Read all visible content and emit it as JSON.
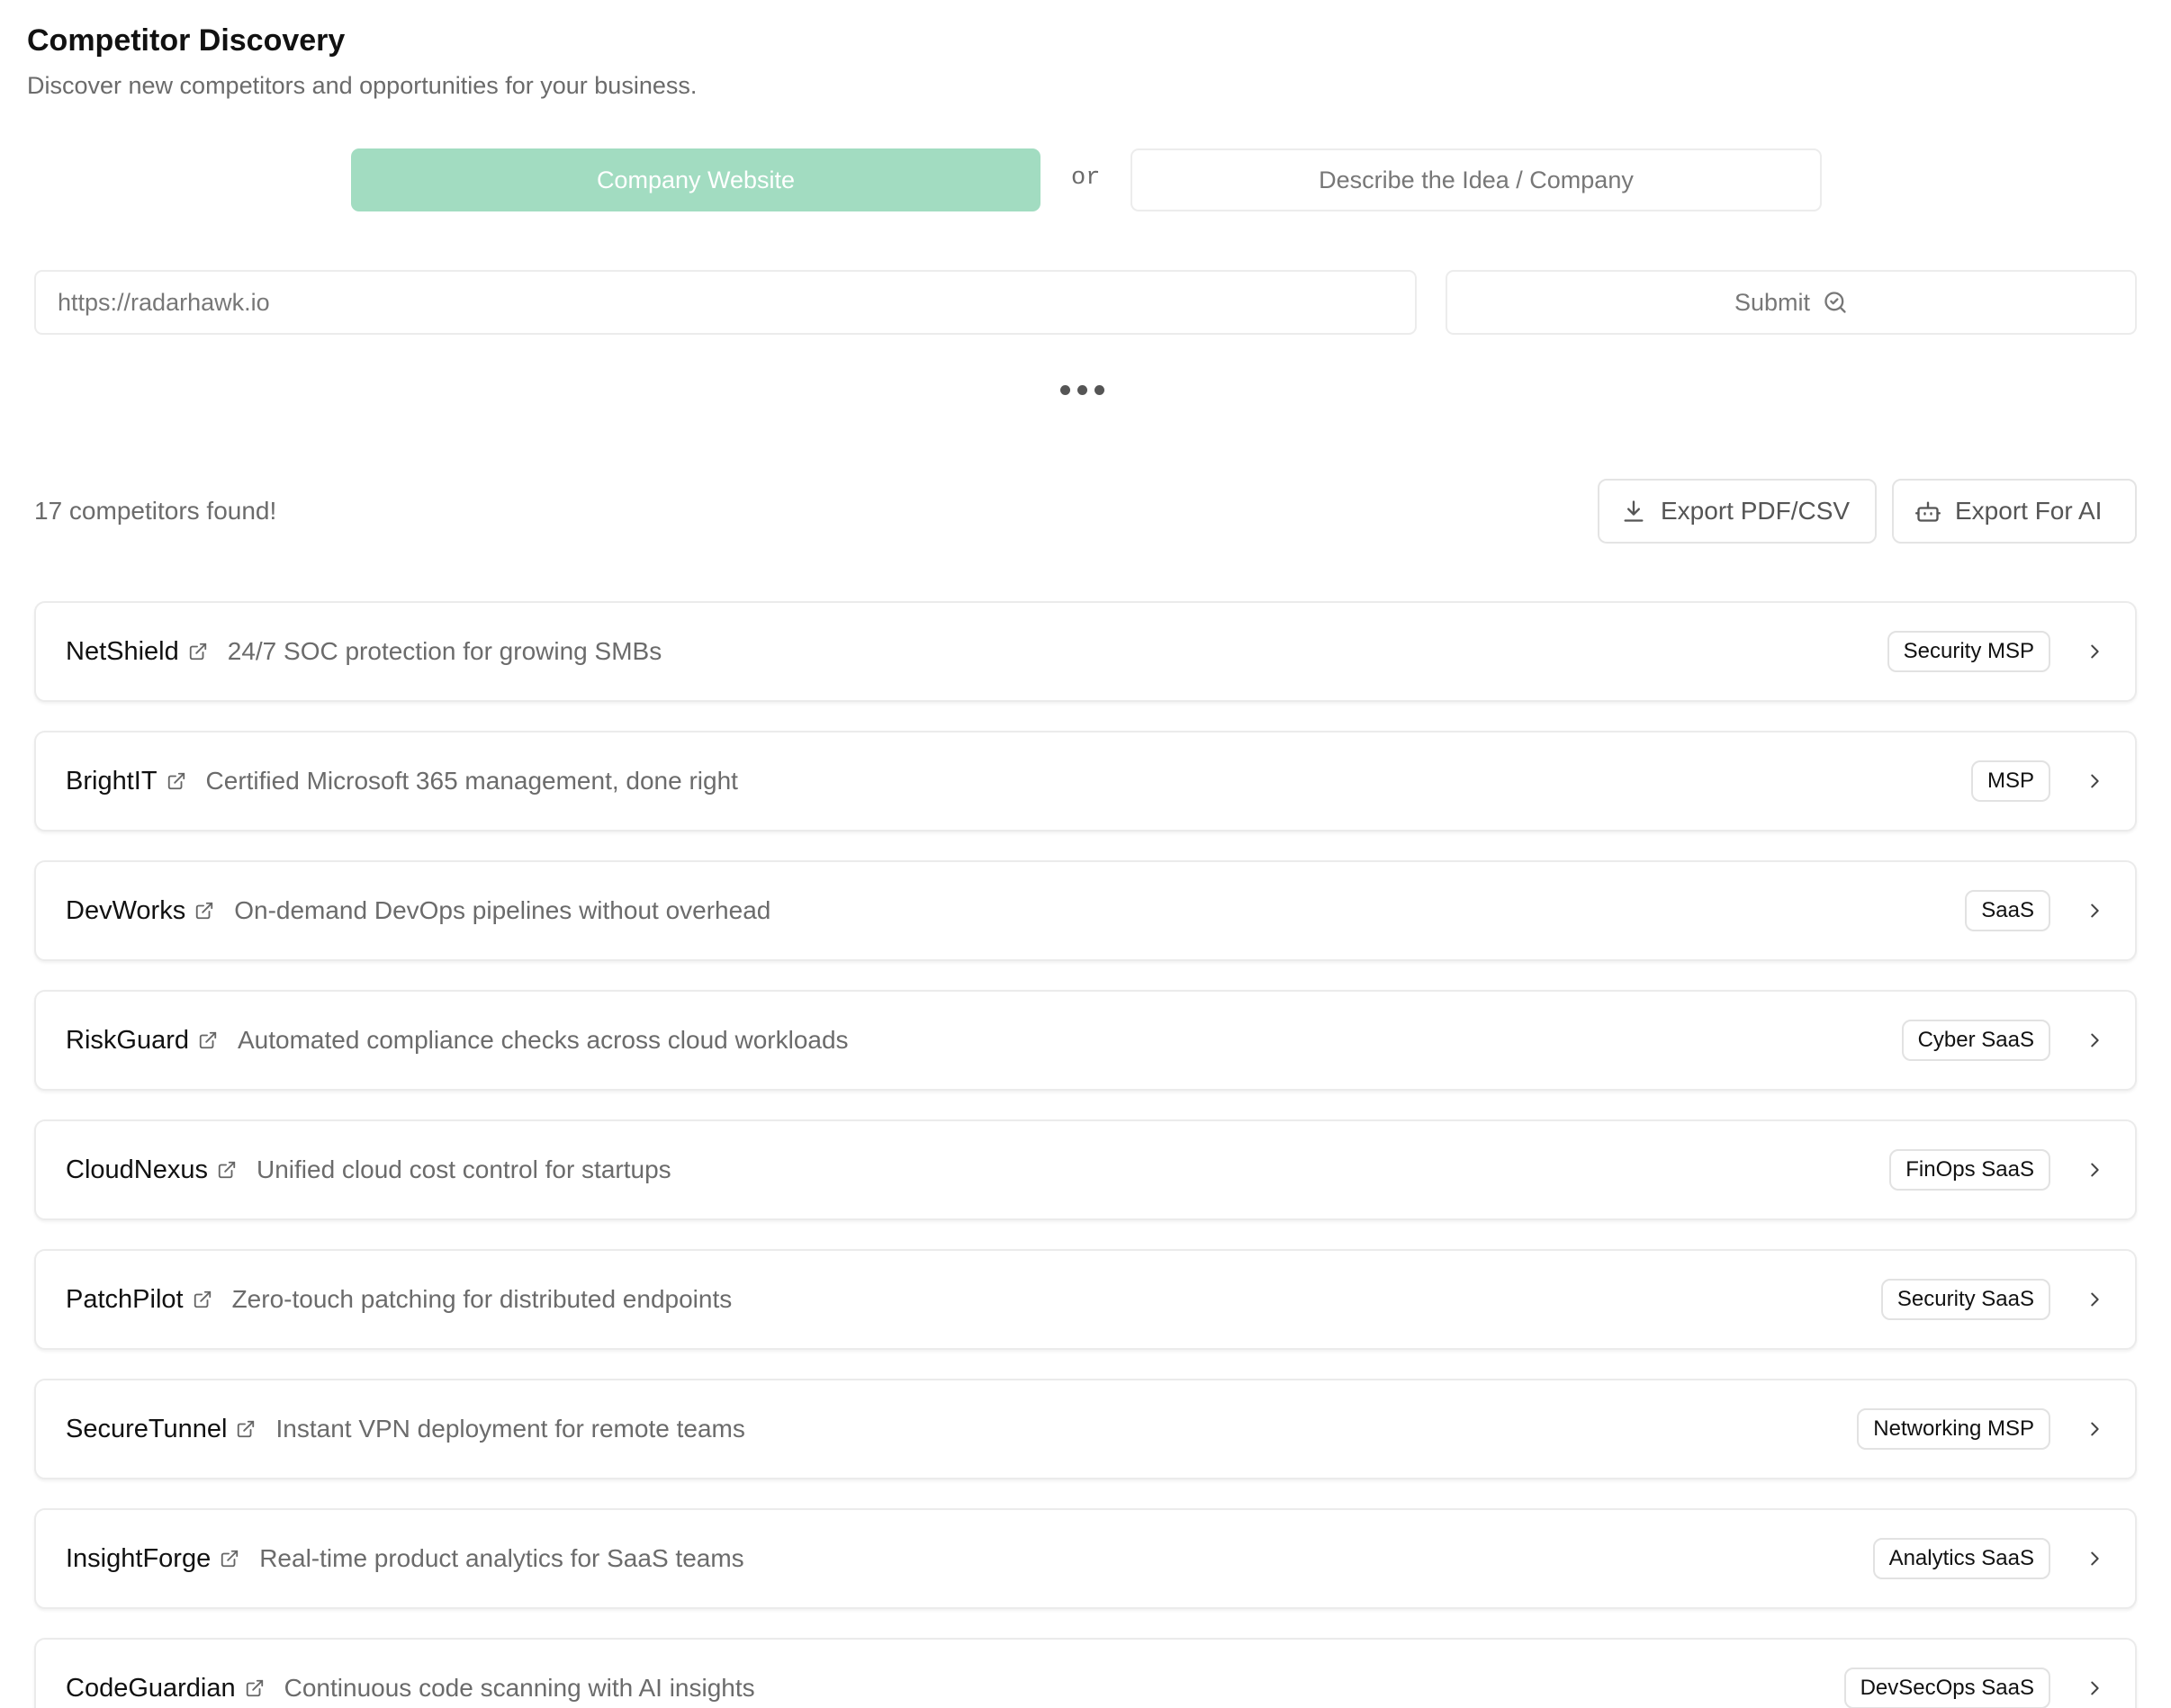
{
  "header": {
    "title": "Competitor Discovery",
    "subtitle": "Discover new competitors and opportunities for your business."
  },
  "mode": {
    "active_label": "Company Website",
    "or_label": "or",
    "inactive_label": "Describe the Idea / Company"
  },
  "search": {
    "placeholder": "https://radarhawk.io",
    "submit_label": "Submit"
  },
  "results": {
    "count_label": "17 competitors found!",
    "export_pdf_label": "Export PDF/CSV",
    "export_ai_label": "Export For AI"
  },
  "competitors": [
    {
      "name": "NetShield",
      "description": "24/7 SOC protection for growing SMBs",
      "tag": "Security MSP"
    },
    {
      "name": "BrightIT",
      "description": "Certified Microsoft 365 management, done right",
      "tag": "MSP"
    },
    {
      "name": "DevWorks",
      "description": "On-demand DevOps pipelines without overhead",
      "tag": "SaaS"
    },
    {
      "name": "RiskGuard",
      "description": "Automated compliance checks across cloud workloads",
      "tag": "Cyber SaaS"
    },
    {
      "name": "CloudNexus",
      "description": "Unified cloud cost control for startups",
      "tag": "FinOps SaaS"
    },
    {
      "name": "PatchPilot",
      "description": "Zero-touch patching for distributed endpoints",
      "tag": "Security SaaS"
    },
    {
      "name": "SecureTunnel",
      "description": "Instant VPN deployment for remote teams",
      "tag": "Networking MSP"
    },
    {
      "name": "InsightForge",
      "description": "Real-time product analytics for SaaS teams",
      "tag": "Analytics SaaS"
    },
    {
      "name": "CodeGuardian",
      "description": "Continuous code scanning with AI insights",
      "tag": "DevSecOps SaaS"
    }
  ],
  "icons": {
    "submit": "search-check-icon",
    "export_pdf": "download-icon",
    "export_ai": "bot-icon",
    "row_link": "external-link-icon",
    "row_open": "chevron-right-icon",
    "loading": "loading-dots-icon"
  },
  "colors": {
    "accent": "#a2dcc1",
    "muted_text": "#6b6b6b",
    "border": "#ececec"
  }
}
